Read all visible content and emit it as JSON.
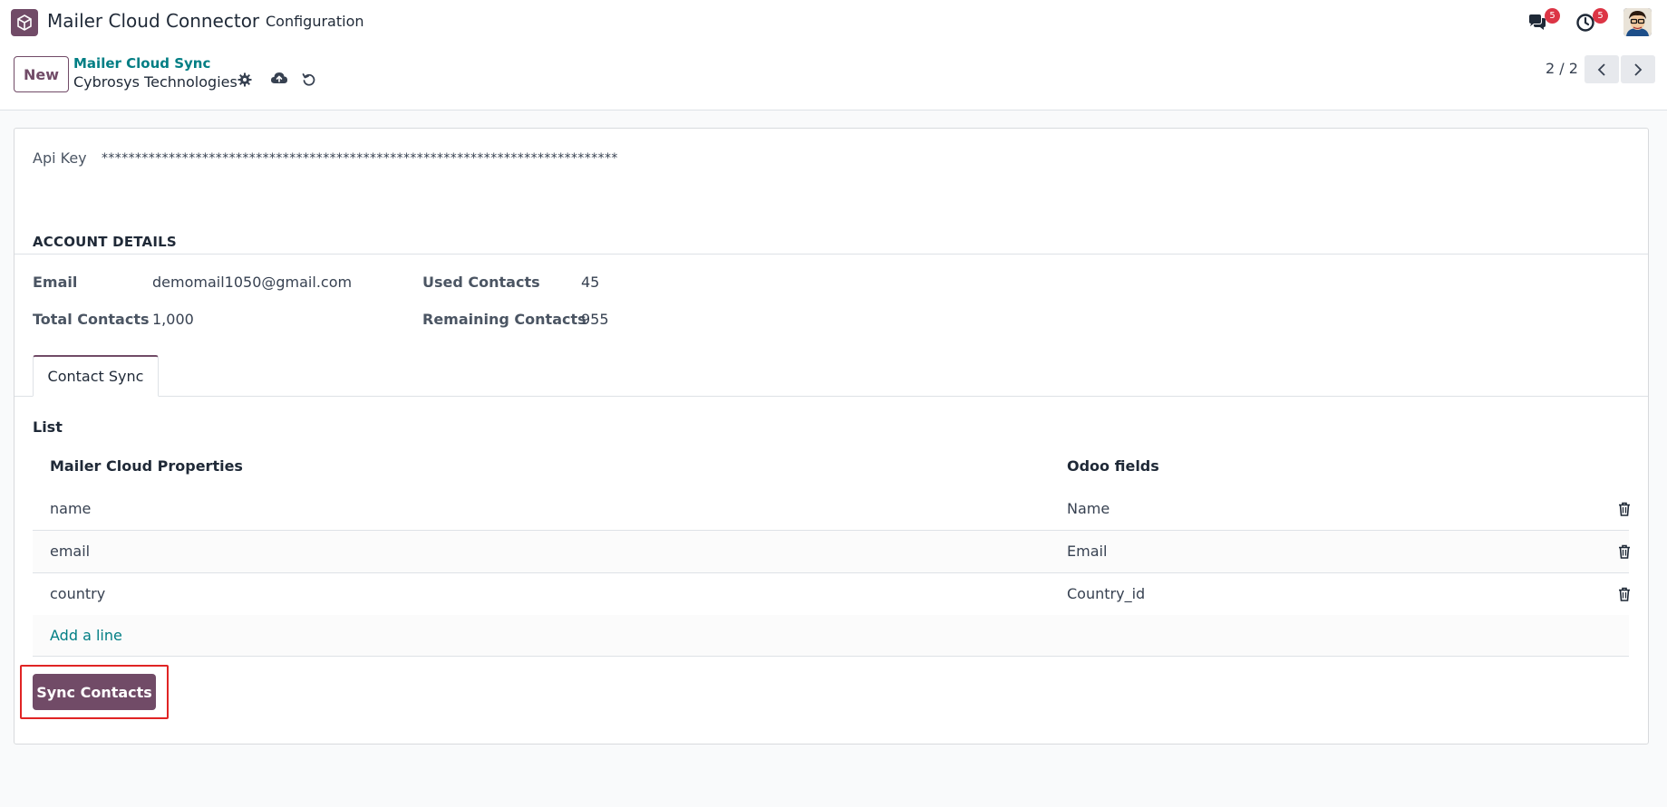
{
  "navbar": {
    "app_name": "Mailer Cloud Connector",
    "menu_configuration": "Configuration",
    "messages_count": "5",
    "activities_count": "5"
  },
  "control_panel": {
    "new_label": "New",
    "breadcrumb_parent": "Mailer Cloud Sync",
    "record_title": "Cybrosys Technologies",
    "pager_value": "2 / 2"
  },
  "form": {
    "api_key_label": "Api Key",
    "api_key_value": "*****************************************************************************",
    "account_section_title": "ACCOUNT DETAILS",
    "email_label": "Email",
    "email_value": "demomail1050@gmail.com",
    "total_contacts_label": "Total Contacts",
    "total_contacts_value": "1,000",
    "used_contacts_label": "Used Contacts",
    "used_contacts_value": "45",
    "remaining_contacts_label": "Remaining Contacts",
    "remaining_contacts_value": "955"
  },
  "tabs": [
    {
      "label": "Contact Sync",
      "active": true
    }
  ],
  "list": {
    "label": "List",
    "columns": [
      "Mailer Cloud Properties",
      "Odoo fields"
    ],
    "rows": [
      {
        "property": "name",
        "field": "Name"
      },
      {
        "property": "email",
        "field": "Email"
      },
      {
        "property": "country",
        "field": "Country_id"
      }
    ],
    "add_line_label": "Add a line"
  },
  "actions": {
    "sync_contacts_label": "Sync Contacts"
  },
  "colors": {
    "brand": "#714b67",
    "link": "#017e84",
    "badge": "#dc3545",
    "highlight": "#e02424"
  }
}
